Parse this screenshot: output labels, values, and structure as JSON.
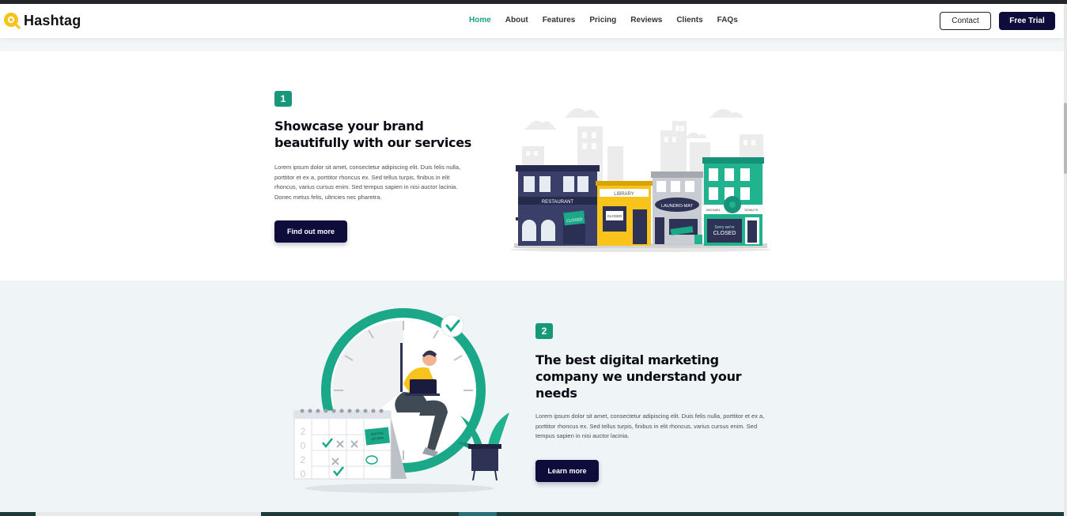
{
  "brand": {
    "name": "Hashtag",
    "accent": "#17987a",
    "dark": "#0d0c3a",
    "logo_color": "#f7c21a"
  },
  "nav": {
    "links": [
      "Home",
      "About",
      "Features",
      "Pricing",
      "Reviews",
      "Clients",
      "FAQs"
    ],
    "contact_label": "Contact",
    "trial_label": "Free Trial"
  },
  "section1": {
    "number": "1",
    "heading_line1": "Showcase your brand",
    "heading_line2": "beautifully with our services",
    "body_lines": [
      "Lorem ipsum dolor sit amet, consectetur adipiscing elit. Duis felis nulla,",
      "porttitor et ex a, porttitor rhoncus ex. Sed tellus turpis, finibus in elit",
      "rhoncus, varius cursus enim. Sed tempus sapien in nisi auctor lacinia.",
      "Donec metus felis, ultricies nec pharetra."
    ],
    "cta_label": "Find out more",
    "illustration": {
      "restaurant_sign": "RESTAURANT",
      "library_sign": "LIBRARY",
      "laundromat_sign": "LAUNDRO-MAT",
      "closed_sign": "CLOSED",
      "donut_left": "MICHAEL",
      "donut_right": "DONUTS",
      "sorry_text": "Sorry we're",
      "sorry_closed": "CLOSED"
    }
  },
  "section2": {
    "number": "2",
    "heading_line1": "The best digital marketing",
    "heading_line2": "company we understand your",
    "heading_line3": "needs",
    "body_lines": [
      "Lorem ipsum dolor sit amet, consectetur adipiscing elit. Duis felis nulla, porttitor et ex a,",
      "porttitor rhoncus ex. Sed tellus turpis, finibus in elit rhoncus, varius cursus enim. Sed",
      "tempus sapien in nisi auctor lacinia."
    ],
    "cta_label": "Learn more",
    "illustration": {
      "year_digits": [
        "2",
        "0",
        "2",
        "0"
      ],
      "note_line1": "MEETING",
      "note_line2": "10h 30AM"
    }
  }
}
